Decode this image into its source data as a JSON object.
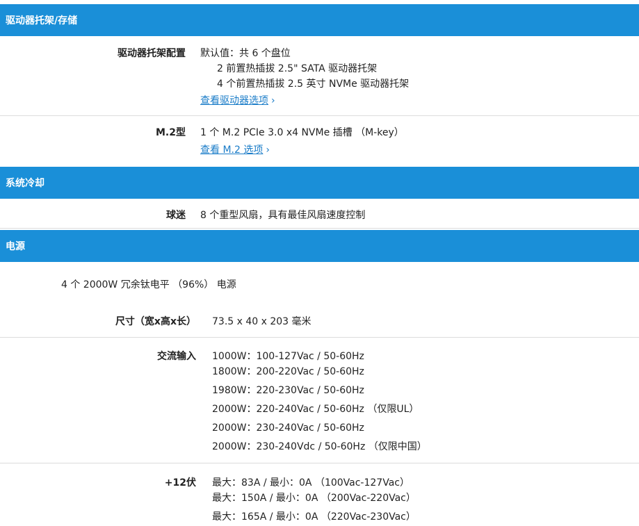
{
  "sections": {
    "drive_bay": {
      "header": "驱动器托架/存储",
      "config_label": "驱动器托架配置",
      "config_lines": [
        "默认值：共 6 个盘位",
        "2 前置热插拔 2.5\" SATA 驱动器托架",
        "4 个前置热插拔 2.5 英寸 NVMe 驱动器托架"
      ],
      "config_link": "查看驱动器选项",
      "m2_label": "M.2型",
      "m2_value": "1 个 M.2 PCIe 3.0 x4 NVMe 插槽 （M-key）",
      "m2_link": "查看 M.2 选项"
    },
    "cooling": {
      "header": "系统冷却",
      "fan_label": "球迷",
      "fan_value": "8 个重型风扇，具有最佳风扇速度控制"
    },
    "power": {
      "header": "电源",
      "summary": "4 个 2000W 冗余钛电平 （96%） 电源",
      "size_label": "尺寸（宽x高x长）",
      "size_value": "73.5 x 40 x 203 毫米",
      "ac_label": "交流输入",
      "ac_lines": [
        "1000W：100-127Vac / 50-60Hz",
        "1800W：200-220Vac / 50-60Hz",
        "1980W：220-230Vac / 50-60Hz",
        "2000W：220-240Vac / 50-60Hz （仅限UL）",
        "2000W：230-240Vac / 50-60Hz",
        "2000W：230-240Vdc / 50-60Hz （仅限中国）"
      ],
      "v12_label": "+12伏",
      "v12_lines": [
        "最大：83A / 最小：0A （100Vac-127Vac）",
        "最大：150A / 最小：0A （200Vac-220Vac）",
        "最大：165A / 最小：0A （220Vac-230Vac）"
      ]
    }
  },
  "icons": {
    "link_arrow": "chevron-right-icon"
  },
  "colors": {
    "header_bg": "#1a8fd8",
    "link": "#1a7cc8"
  }
}
